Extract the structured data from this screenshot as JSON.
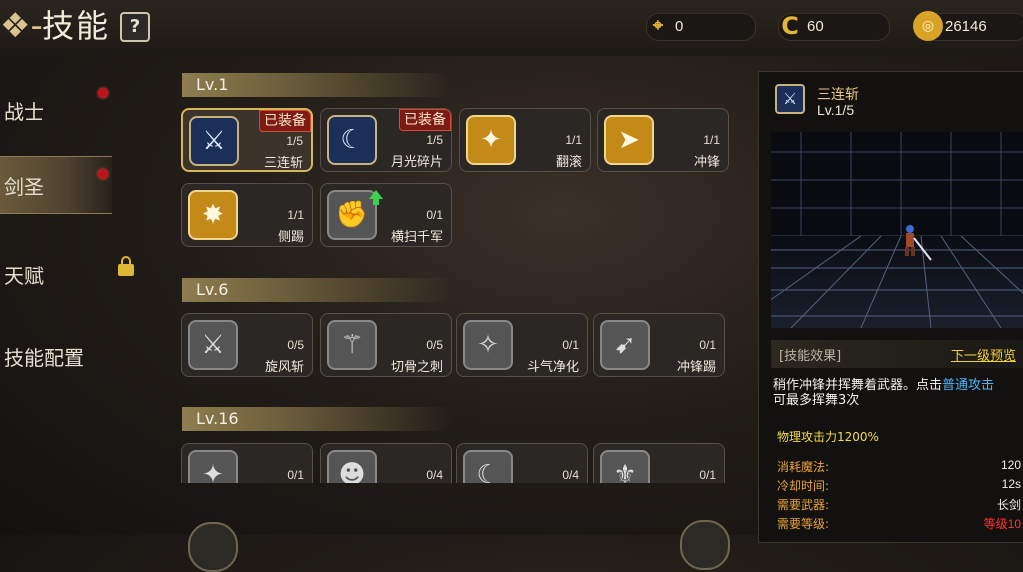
{
  "header": {
    "title": "技能",
    "help_label": "?",
    "currencies": [
      {
        "icon": "crosshair-token-icon",
        "value": "0",
        "color": "#e4b43a"
      },
      {
        "icon": "c-coin-icon",
        "value": "60",
        "color": "#e4b43a"
      },
      {
        "icon": "gold-coin-icon",
        "value": "26146",
        "color": "#e4b43a"
      }
    ]
  },
  "sidebar": {
    "items": [
      {
        "label": "战士",
        "badge": "red-dot"
      },
      {
        "label": "剑圣",
        "badge": "red-dot",
        "active": true
      },
      {
        "label": "天赋",
        "badge": "lock"
      },
      {
        "label": "技能配置"
      }
    ]
  },
  "levels": [
    {
      "label": "Lv.1",
      "skills": [
        {
          "name": "三连斩",
          "count": "1/5",
          "tag": "已装备",
          "icon": "triple-slash-icon",
          "selected": true
        },
        {
          "name": "月光碎片",
          "count": "1/5",
          "tag": "已装备",
          "icon": "moonlight-shard-icon"
        },
        {
          "name": "翻滚",
          "count": "1/1",
          "icon": "roll-icon"
        },
        {
          "name": "冲锋",
          "count": "1/1",
          "icon": "charge-icon"
        },
        {
          "name": "侧踢",
          "count": "1/1",
          "icon": "side-kick-icon"
        },
        {
          "name": "横扫千军",
          "count": "0/1",
          "icon": "sweep-icon",
          "upgrade": true
        }
      ]
    },
    {
      "label": "Lv.6",
      "skills": [
        {
          "name": "旋风斩",
          "count": "0/5",
          "icon": "whirlwind-icon"
        },
        {
          "name": "切骨之刺",
          "count": "0/5",
          "icon": "bone-pierce-icon"
        },
        {
          "name": "斗气净化",
          "count": "0/1",
          "icon": "aura-purify-icon"
        },
        {
          "name": "冲锋踢",
          "count": "0/1",
          "icon": "charge-kick-icon"
        }
      ]
    },
    {
      "label": "Lv.16",
      "skills": [
        {
          "count": "0/1",
          "icon": "skill-locked-1-icon"
        },
        {
          "count": "0/4",
          "icon": "skill-locked-2-icon"
        },
        {
          "count": "0/4",
          "icon": "skill-locked-3-icon"
        },
        {
          "count": "0/1",
          "icon": "skill-locked-4-icon"
        }
      ]
    }
  ],
  "detail": {
    "name": "三连斩",
    "level": "Lv.1/5",
    "effect_title": "[技能效果]",
    "next_preview": "下一级预览",
    "desc_part1": "稍作冲锋并挥舞着武器。点击",
    "desc_highlight": "普通攻击",
    "desc_part2": "可最多挥舞3次",
    "attack": "物理攻击力1200%",
    "stats": [
      {
        "key": "消耗魔法:",
        "value": "120"
      },
      {
        "key": "冷却时间:",
        "value": "12s"
      },
      {
        "key": "需要武器:",
        "value": "长剑"
      },
      {
        "key": "需要等级:",
        "value": "等级10",
        "red": true
      }
    ]
  }
}
